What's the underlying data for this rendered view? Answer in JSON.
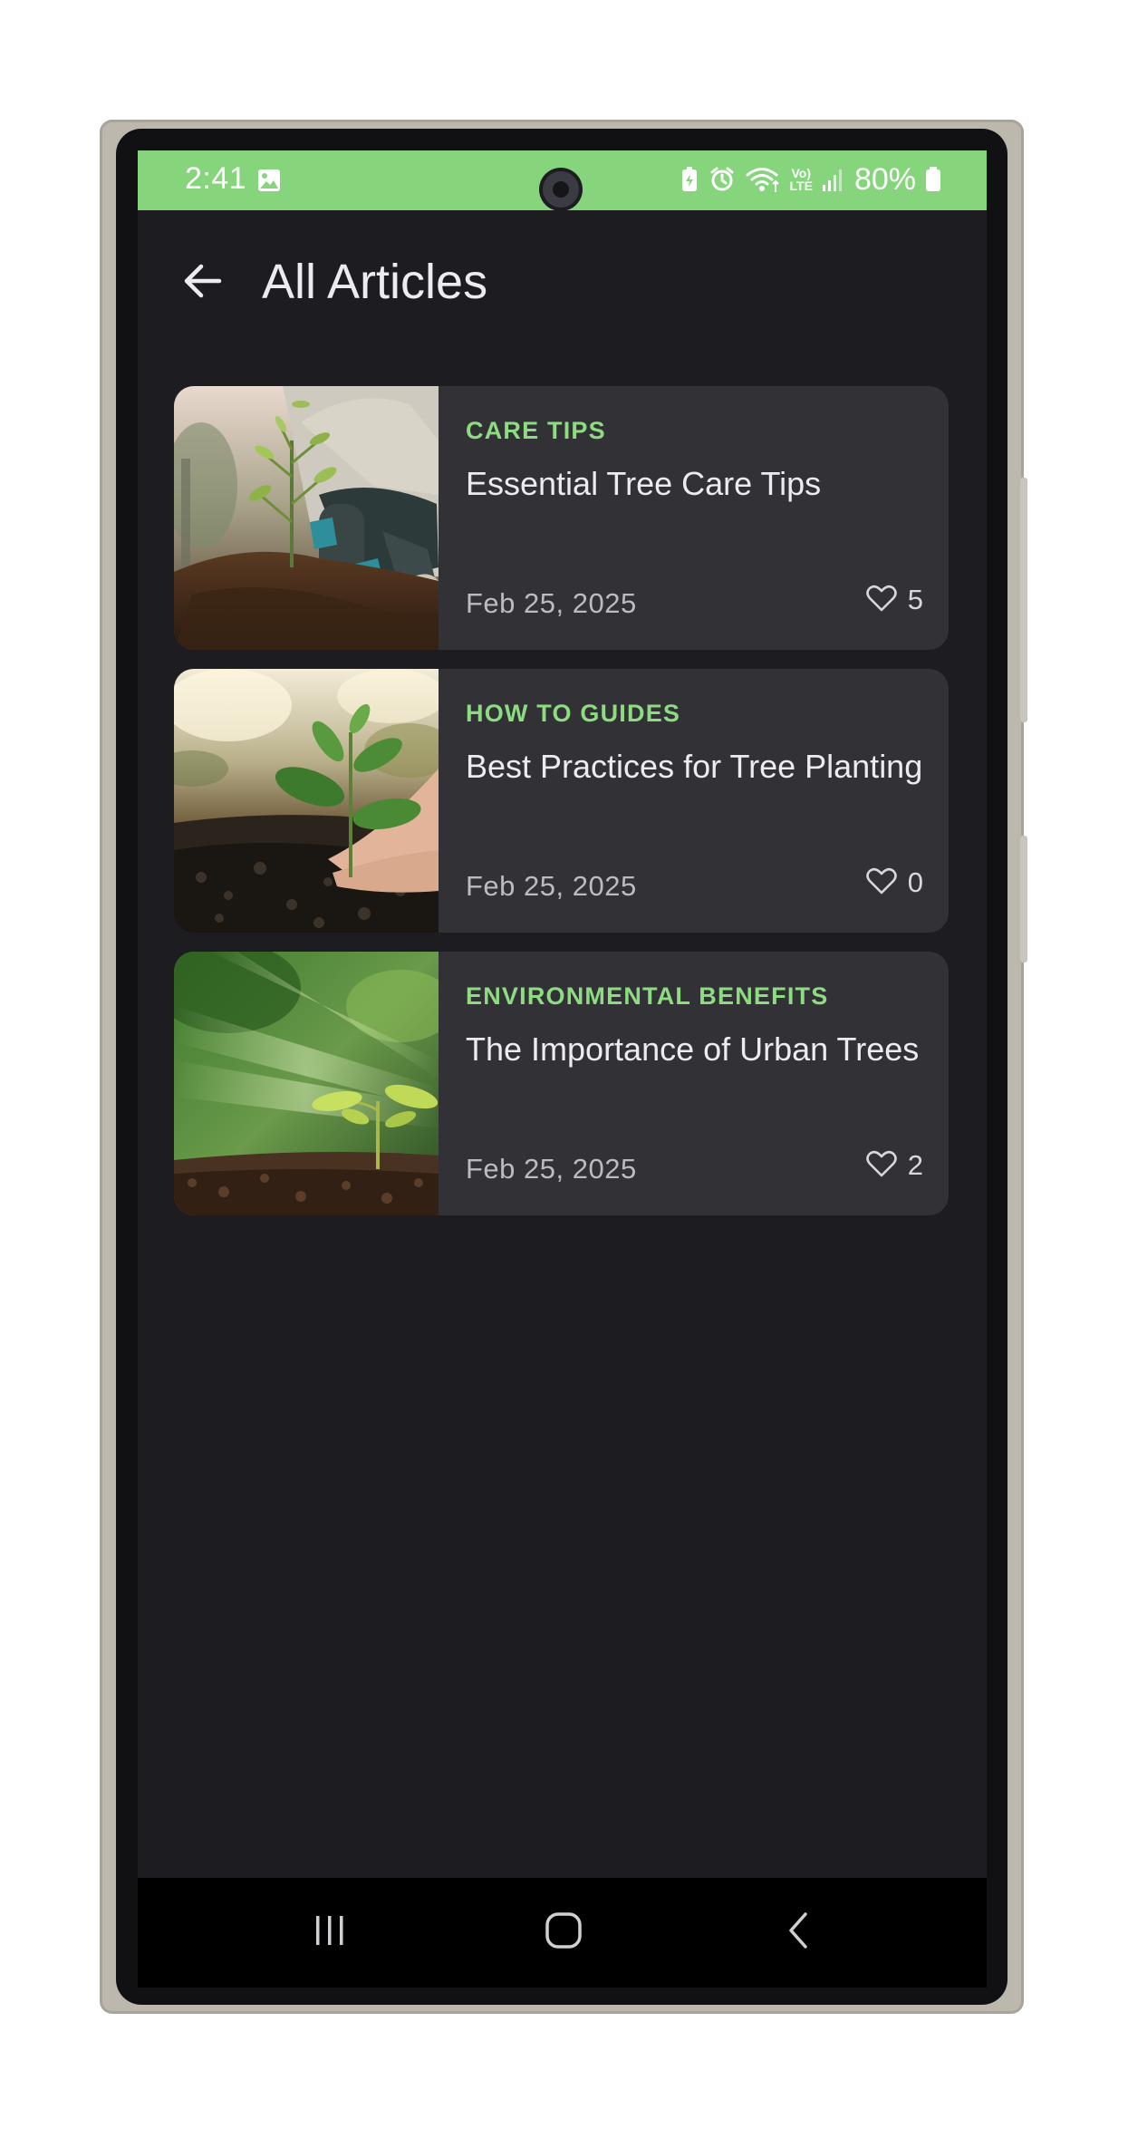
{
  "status_bar": {
    "time": "2:41",
    "battery_percent": "80%",
    "background_color": "#86d57c",
    "icons": [
      "image-icon",
      "battery-saver-icon",
      "alarm-icon",
      "wifi-icon",
      "volte-icon",
      "signal-icon",
      "battery-icon"
    ],
    "volte_top": "Vo)",
    "volte_bottom": "LTE"
  },
  "app_bar": {
    "title": "All Articles",
    "back_icon": "arrow-back-icon"
  },
  "articles": [
    {
      "category": "CARE TIPS",
      "title": "Essential Tree Care Tips",
      "date": "Feb 25, 2025",
      "likes": "5",
      "image": "person-planting-sapling-photo"
    },
    {
      "category": "HOW TO GUIDES",
      "title": "Best Practices for Tree Planting",
      "date": "Feb 25, 2025",
      "likes": "0",
      "image": "hands-planting-seedling-photo"
    },
    {
      "category": "ENVIRONMENTAL BENEFITS",
      "title": "The Importance of Urban Trees",
      "date": "Feb 25, 2025",
      "likes": "2",
      "image": "sprout-in-sunlight-photo"
    }
  ],
  "theme": {
    "accent": "#8ddc82",
    "background": "#1d1c21",
    "card": "#323136"
  },
  "nav_bar": {
    "icons": [
      "recent-apps-icon",
      "home-icon",
      "back-icon"
    ]
  }
}
